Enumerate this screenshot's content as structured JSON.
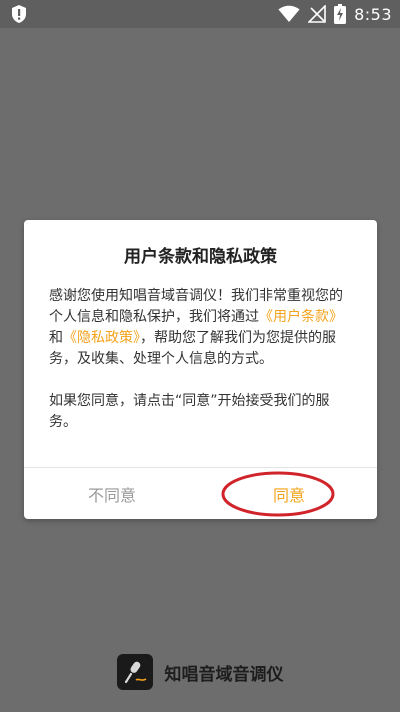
{
  "status_bar": {
    "time": "8:53",
    "icons": [
      "alert-icon",
      "wifi-icon",
      "no-signal-icon",
      "battery-charging-icon"
    ]
  },
  "dialog": {
    "title": "用户条款和隐私政策",
    "body_p1_a": "感谢您使用知唱音域音调仪！我们非常重视您的个人信息和隐私保护，我们将通过",
    "link_terms": "《用户条款》",
    "body_p1_and": "和",
    "link_privacy": "《隐私政策》",
    "body_p1_b": "，帮助您了解我们为您提供的服务，及收集、处理个人信息的方式。",
    "body_p2": "如果您同意，请点击“同意”开始接受我们的服务。",
    "disagree_label": "不同意",
    "agree_label": "同意"
  },
  "brand": {
    "app_name": "知唱音域音调仪",
    "logo_icon": "microphone-app-icon"
  },
  "colors": {
    "accent": "#f3a31d",
    "annotation": "#d0242a",
    "overlay": "#6d6d6d"
  }
}
